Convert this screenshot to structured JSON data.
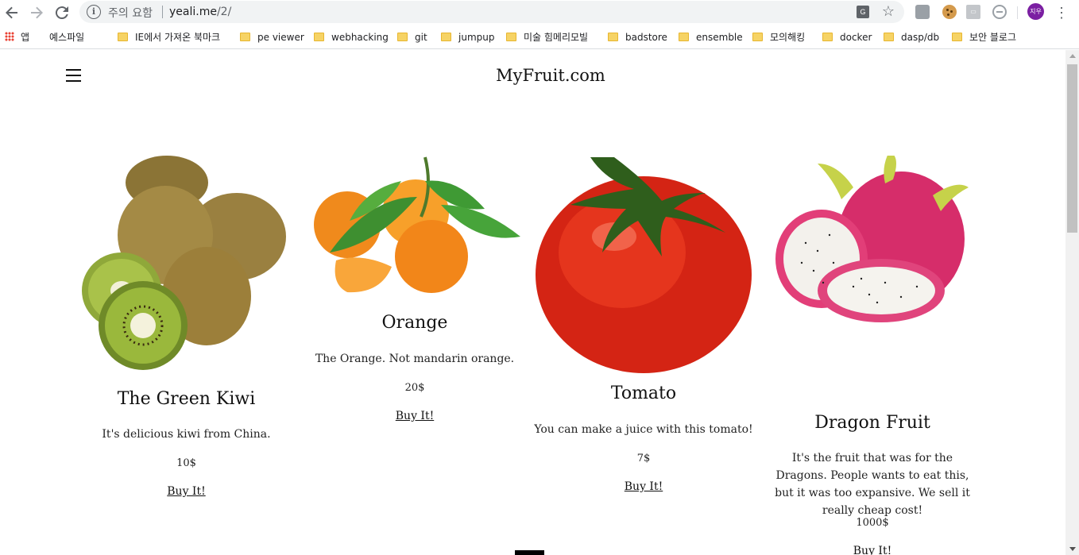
{
  "browser": {
    "back_icon": "arrow-left-icon",
    "forward_icon": "arrow-right-icon",
    "reload_icon": "reload-icon",
    "security_warning": "주의 요함",
    "url_host": "yeali.me",
    "url_path": "/2/",
    "avatar_text": "지우",
    "colors": {
      "omnibox_bg": "#f1f3f4",
      "avatar_bg": "#7b1fa2",
      "folder": "#f6d365"
    }
  },
  "bookmarks": [
    {
      "label": "앱",
      "icon": "apps-grid-icon"
    },
    {
      "label": "예스파일",
      "icon": "page-icon"
    },
    {
      "label": "IE에서 가져온 북마크",
      "icon": "folder-icon"
    },
    {
      "label": "pe viewer",
      "icon": "folder-icon"
    },
    {
      "label": "webhacking",
      "icon": "folder-icon"
    },
    {
      "label": "git",
      "icon": "folder-icon"
    },
    {
      "label": "jumpup",
      "icon": "folder-icon"
    },
    {
      "label": "미술 힘메리모빌",
      "icon": "folder-icon"
    },
    {
      "label": "badstore",
      "icon": "folder-icon"
    },
    {
      "label": "ensemble",
      "icon": "folder-icon"
    },
    {
      "label": "모의해킹",
      "icon": "folder-icon"
    },
    {
      "label": "docker",
      "icon": "folder-icon"
    },
    {
      "label": "dasp/db",
      "icon": "folder-icon"
    },
    {
      "label": "보안 블로그",
      "icon": "folder-icon"
    }
  ],
  "site": {
    "title": "MyFruit.com",
    "menu_icon": "hamburger-menu-icon"
  },
  "products": [
    {
      "name": "The Green Kiwi",
      "description": "It's delicious kiwi from China.",
      "price": "10$",
      "buy_label": "Buy It!",
      "image": "kiwi-image"
    },
    {
      "name": "Orange",
      "description": "The Orange. Not mandarin orange.",
      "price": "20$",
      "buy_label": "Buy It!",
      "image": "orange-image"
    },
    {
      "name": "Tomato",
      "description": "You can make a juice with this tomato!",
      "price": "7$",
      "buy_label": "Buy It!",
      "image": "tomato-image"
    },
    {
      "name": "Dragon Fruit",
      "description": "It's the fruit that was for the Dragons. People wants to eat this, but it was too expansive. We sell it really cheap cost!",
      "price": "1000$",
      "buy_label": "Buy It!",
      "image": "dragon-fruit-image"
    }
  ]
}
